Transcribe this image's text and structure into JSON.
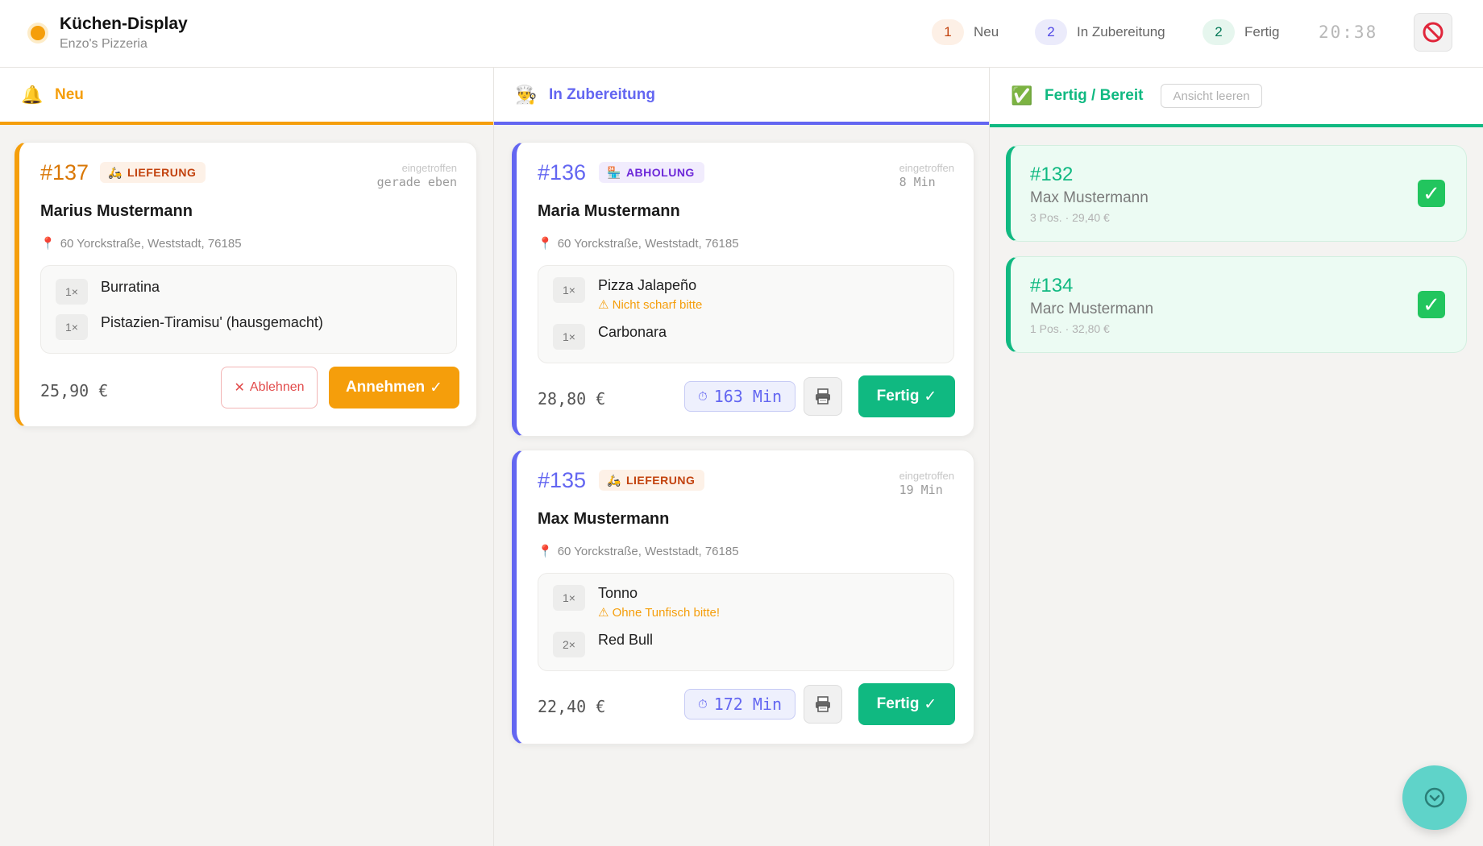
{
  "header": {
    "title": "Küchen-Display",
    "subtitle": "Enzo's Pizzeria",
    "counters": [
      {
        "count": "1",
        "label": "Neu"
      },
      {
        "count": "2",
        "label": "In Zubereitung"
      },
      {
        "count": "2",
        "label": "Fertig"
      }
    ],
    "clock": "20:38",
    "status_color": "#f59e0b"
  },
  "columns": {
    "neu": {
      "icon": "🔔",
      "title": "Neu",
      "accent": "#f59e0b"
    },
    "zub": {
      "icon": "👨‍🍳",
      "title": "In Zubereitung",
      "accent": "#6366f1"
    },
    "fer": {
      "icon": "✅",
      "title": "Fertig / Bereit",
      "accent": "#10b981",
      "clear_label": "Ansicht leeren"
    }
  },
  "arrived_label": "eingetroffen",
  "orders_new": [
    {
      "number": "#137",
      "type_icon": "🛵",
      "type": "LIEFERUNG",
      "arrived": "gerade eben",
      "customer": "Marius Mustermann",
      "address": "60 Yorckstraße, Weststadt, 76185",
      "items": [
        {
          "qty": "1×",
          "name": "Burratina"
        },
        {
          "qty": "1×",
          "name": "Pistazien-Tiramisu' (hausgemacht)"
        }
      ],
      "total": "25,90 €",
      "reject_label": "Ablehnen",
      "accept_label": "Annehmen"
    }
  ],
  "orders_prep": [
    {
      "number": "#136",
      "type_icon": "🏪",
      "type": "ABHOLUNG",
      "arrived": "8 Min",
      "customer": "Maria Mustermann",
      "address": "60 Yorckstraße, Weststadt, 76185",
      "items": [
        {
          "qty": "1×",
          "name": "Pizza Jalapeño",
          "note": "⚠ Nicht scharf bitte"
        },
        {
          "qty": "1×",
          "name": "Carbonara"
        }
      ],
      "total": "28,80 €",
      "timer": "163 Min",
      "done_label": "Fertig"
    },
    {
      "number": "#135",
      "type_icon": "🛵",
      "type": "LIEFERUNG",
      "arrived": "19 Min",
      "customer": "Max Mustermann",
      "address": "60 Yorckstraße, Weststadt, 76185",
      "items": [
        {
          "qty": "1×",
          "name": "Tonno",
          "note": "⚠ Ohne Tunfisch bitte!"
        },
        {
          "qty": "2×",
          "name": "Red Bull"
        }
      ],
      "total": "22,40 €",
      "timer": "172 Min",
      "done_label": "Fertig"
    }
  ],
  "orders_done": [
    {
      "number": "#132",
      "customer": "Max Mustermann",
      "meta": "3 Pos. · 29,40 €"
    },
    {
      "number": "#134",
      "customer": "Marc Mustermann",
      "meta": "1 Pos. · 32,80 €"
    }
  ]
}
